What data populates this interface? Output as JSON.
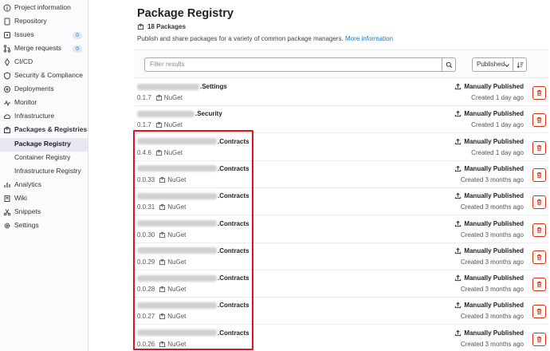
{
  "sidebar": {
    "items": [
      {
        "label": "Project information",
        "icon": "info-icon"
      },
      {
        "label": "Repository",
        "icon": "doc-icon"
      },
      {
        "label": "Issues",
        "icon": "issues-icon",
        "badge": "0"
      },
      {
        "label": "Merge requests",
        "icon": "merge-icon",
        "badge": "0"
      },
      {
        "label": "CI/CD",
        "icon": "rocket-icon"
      },
      {
        "label": "Security & Compliance",
        "icon": "shield-icon"
      },
      {
        "label": "Deployments",
        "icon": "deploy-icon"
      },
      {
        "label": "Monitor",
        "icon": "monitor-icon"
      },
      {
        "label": "Infrastructure",
        "icon": "cloud-icon"
      },
      {
        "label": "Packages & Registries",
        "icon": "package-icon"
      },
      {
        "label": "Package Registry"
      },
      {
        "label": "Container Registry"
      },
      {
        "label": "Infrastructure Registry"
      },
      {
        "label": "Analytics",
        "icon": "chart-icon"
      },
      {
        "label": "Wiki",
        "icon": "book-icon"
      },
      {
        "label": "Snippets",
        "icon": "scissors-icon"
      },
      {
        "label": "Settings",
        "icon": "gear-icon"
      }
    ]
  },
  "page": {
    "title": "Package Registry",
    "count": "18 Packages",
    "description": "Publish and share packages for a variety of common package managers.",
    "more_link": "More information"
  },
  "toolbar": {
    "filter_placeholder": "Filter results",
    "sort_label": "Published"
  },
  "packages": [
    {
      "name_suffix": ".Settings",
      "version": "0.1.7",
      "type": "NuGet",
      "published": "Manually Published",
      "created": "Created 1 day ago"
    },
    {
      "name_suffix": ".Security",
      "version": "0.1.7",
      "type": "NuGet",
      "published": "Manually Published",
      "created": "Created 1 day ago"
    },
    {
      "name_suffix": ".Contracts",
      "version": "0.4.6",
      "type": "NuGet",
      "published": "Manually Published",
      "created": "Created 1 day ago"
    },
    {
      "name_suffix": ".Contracts",
      "version": "0.0.33",
      "type": "NuGet",
      "published": "Manually Published",
      "created": "Created 3 months ago"
    },
    {
      "name_suffix": ".Contracts",
      "version": "0.0.31",
      "type": "NuGet",
      "published": "Manually Published",
      "created": "Created 3 months ago"
    },
    {
      "name_suffix": ".Contracts",
      "version": "0.0.30",
      "type": "NuGet",
      "published": "Manually Published",
      "created": "Created 3 months ago"
    },
    {
      "name_suffix": ".Contracts",
      "version": "0.0.29",
      "type": "NuGet",
      "published": "Manually Published",
      "created": "Created 3 months ago"
    },
    {
      "name_suffix": ".Contracts",
      "version": "0.0.28",
      "type": "NuGet",
      "published": "Manually Published",
      "created": "Created 3 months ago"
    },
    {
      "name_suffix": ".Contracts",
      "version": "0.0.27",
      "type": "NuGet",
      "published": "Manually Published",
      "created": "Created 3 months ago"
    },
    {
      "name_suffix": ".Contracts",
      "version": "0.0.26",
      "type": "NuGet",
      "published": "Manually Published",
      "created": "Created 3 months ago"
    }
  ],
  "colors": {
    "link": "#1f75cb",
    "danger": "#dd2b0e",
    "highlight_box": "#e0141e"
  }
}
